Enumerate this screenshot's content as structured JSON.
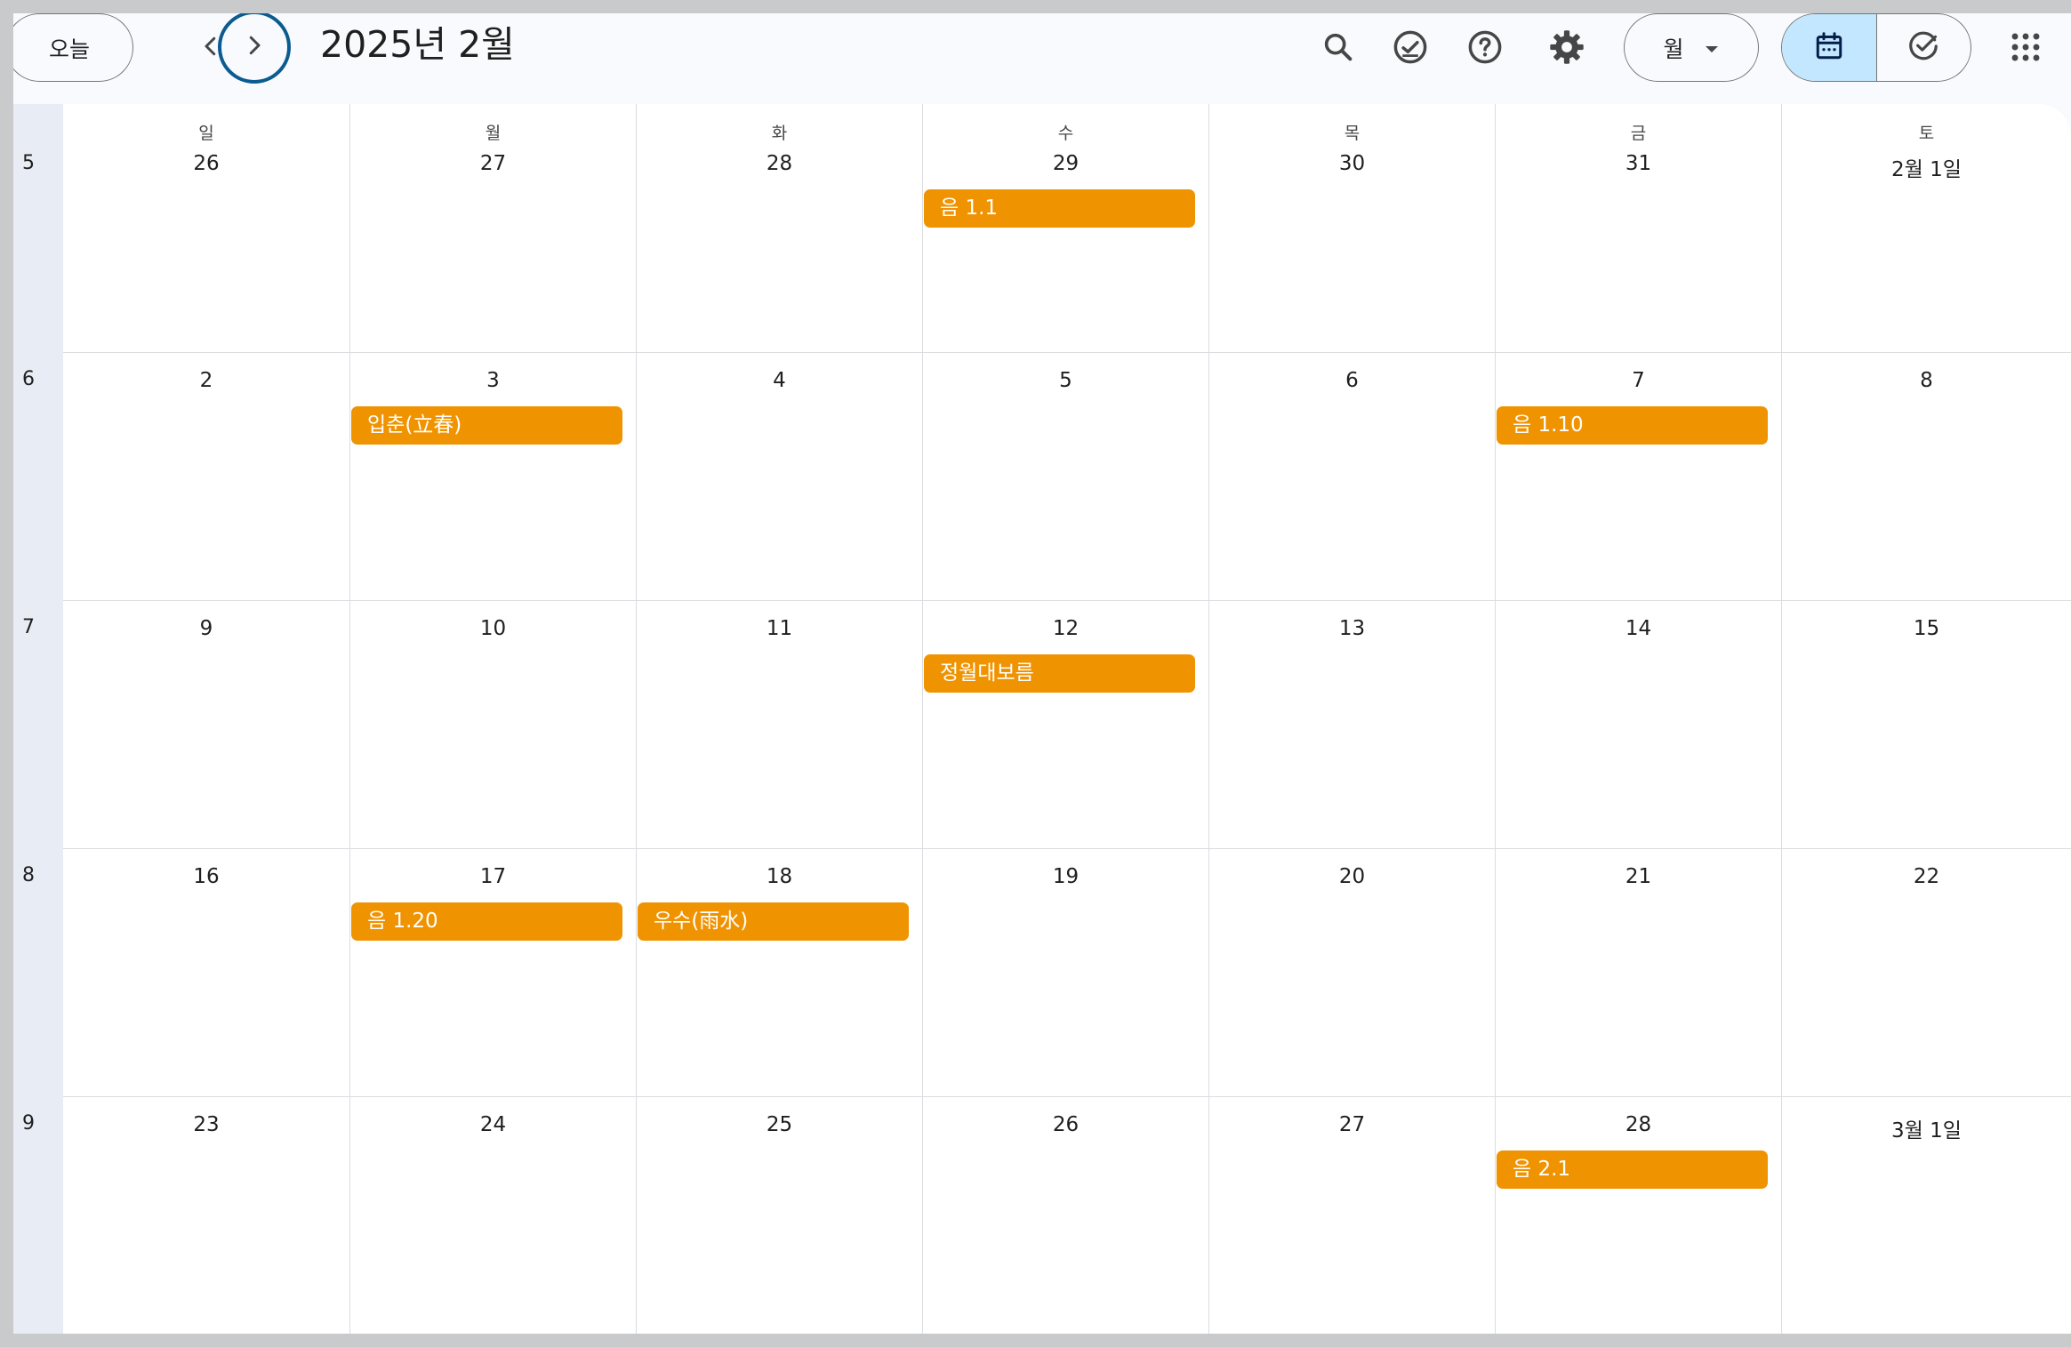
{
  "header": {
    "today_label": "오늘",
    "month_title": "2025년 2월",
    "view_select_label": "월",
    "icons": {
      "prev": "chevron-left-icon",
      "next": "chevron-right-icon",
      "search": "search-icon",
      "tasks_status": "check-circle-icon",
      "help": "help-icon",
      "settings": "gear-icon",
      "calendar_view": "calendar-icon",
      "tasks_view": "tasks-icon",
      "apps": "apps-grid-icon"
    },
    "accent_color": "#c2e7ff",
    "focus_ring_color": "#0b5b91"
  },
  "calendar": {
    "days_of_week": [
      "일",
      "월",
      "화",
      "수",
      "목",
      "금",
      "토"
    ],
    "event_color": "#f09300",
    "weeks": [
      {
        "week_number": "5",
        "days": [
          {
            "label": "26",
            "events": []
          },
          {
            "label": "27",
            "events": []
          },
          {
            "label": "28",
            "events": []
          },
          {
            "label": "29",
            "events": [
              "음 1.1"
            ]
          },
          {
            "label": "30",
            "events": []
          },
          {
            "label": "31",
            "events": []
          },
          {
            "label": "2월 1일",
            "events": []
          }
        ]
      },
      {
        "week_number": "6",
        "days": [
          {
            "label": "2",
            "events": []
          },
          {
            "label": "3",
            "events": [
              "입춘(立春)"
            ]
          },
          {
            "label": "4",
            "events": []
          },
          {
            "label": "5",
            "events": []
          },
          {
            "label": "6",
            "events": []
          },
          {
            "label": "7",
            "events": [
              "음 1.10"
            ]
          },
          {
            "label": "8",
            "events": []
          }
        ]
      },
      {
        "week_number": "7",
        "days": [
          {
            "label": "9",
            "events": []
          },
          {
            "label": "10",
            "events": []
          },
          {
            "label": "11",
            "events": []
          },
          {
            "label": "12",
            "events": [
              "정월대보름"
            ]
          },
          {
            "label": "13",
            "events": []
          },
          {
            "label": "14",
            "events": []
          },
          {
            "label": "15",
            "events": []
          }
        ]
      },
      {
        "week_number": "8",
        "days": [
          {
            "label": "16",
            "events": []
          },
          {
            "label": "17",
            "events": [
              "음 1.20"
            ]
          },
          {
            "label": "18",
            "events": [
              "우수(雨水)"
            ]
          },
          {
            "label": "19",
            "events": []
          },
          {
            "label": "20",
            "events": []
          },
          {
            "label": "21",
            "events": []
          },
          {
            "label": "22",
            "events": []
          }
        ]
      },
      {
        "week_number": "9",
        "days": [
          {
            "label": "23",
            "events": []
          },
          {
            "label": "24",
            "events": []
          },
          {
            "label": "25",
            "events": []
          },
          {
            "label": "26",
            "events": []
          },
          {
            "label": "27",
            "events": []
          },
          {
            "label": "28",
            "events": [
              "음 2.1"
            ]
          },
          {
            "label": "3월 1일",
            "events": []
          }
        ]
      }
    ]
  }
}
